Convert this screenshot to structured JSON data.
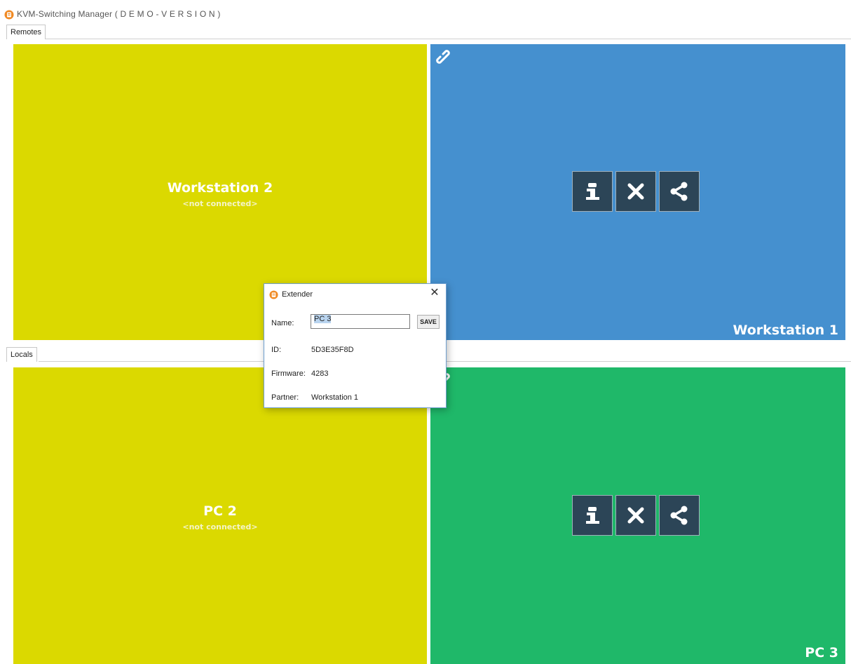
{
  "window": {
    "title": "KVM-Switching Manager ( D E M O - V E R S I O N )"
  },
  "tabs": {
    "remotes_label": "Remotes",
    "locals_label": "Locals"
  },
  "remotes": [
    {
      "name": "Workstation 2",
      "status": "<not connected>",
      "color": "#dbd900"
    },
    {
      "name": "Workstation 1",
      "color": "#4590cf"
    }
  ],
  "locals": [
    {
      "name": "PC 2",
      "status": "<not connected>",
      "color": "#dbd900"
    },
    {
      "name": "PC 3",
      "color": "#1fb869"
    }
  ],
  "actions": {
    "info_icon": "info-icon",
    "disconnect_icon": "close-icon",
    "share_icon": "share-icon"
  },
  "dialog": {
    "title": "Extender",
    "name_label": "Name:",
    "name_value": "PC 3",
    "save_label": "SAVE",
    "id_label": "ID:",
    "id_value": "5D3E35F8D",
    "firmware_label": "Firmware:",
    "firmware_value": "4283",
    "partner_label": "Partner:",
    "partner_value": "Workstation 1"
  }
}
